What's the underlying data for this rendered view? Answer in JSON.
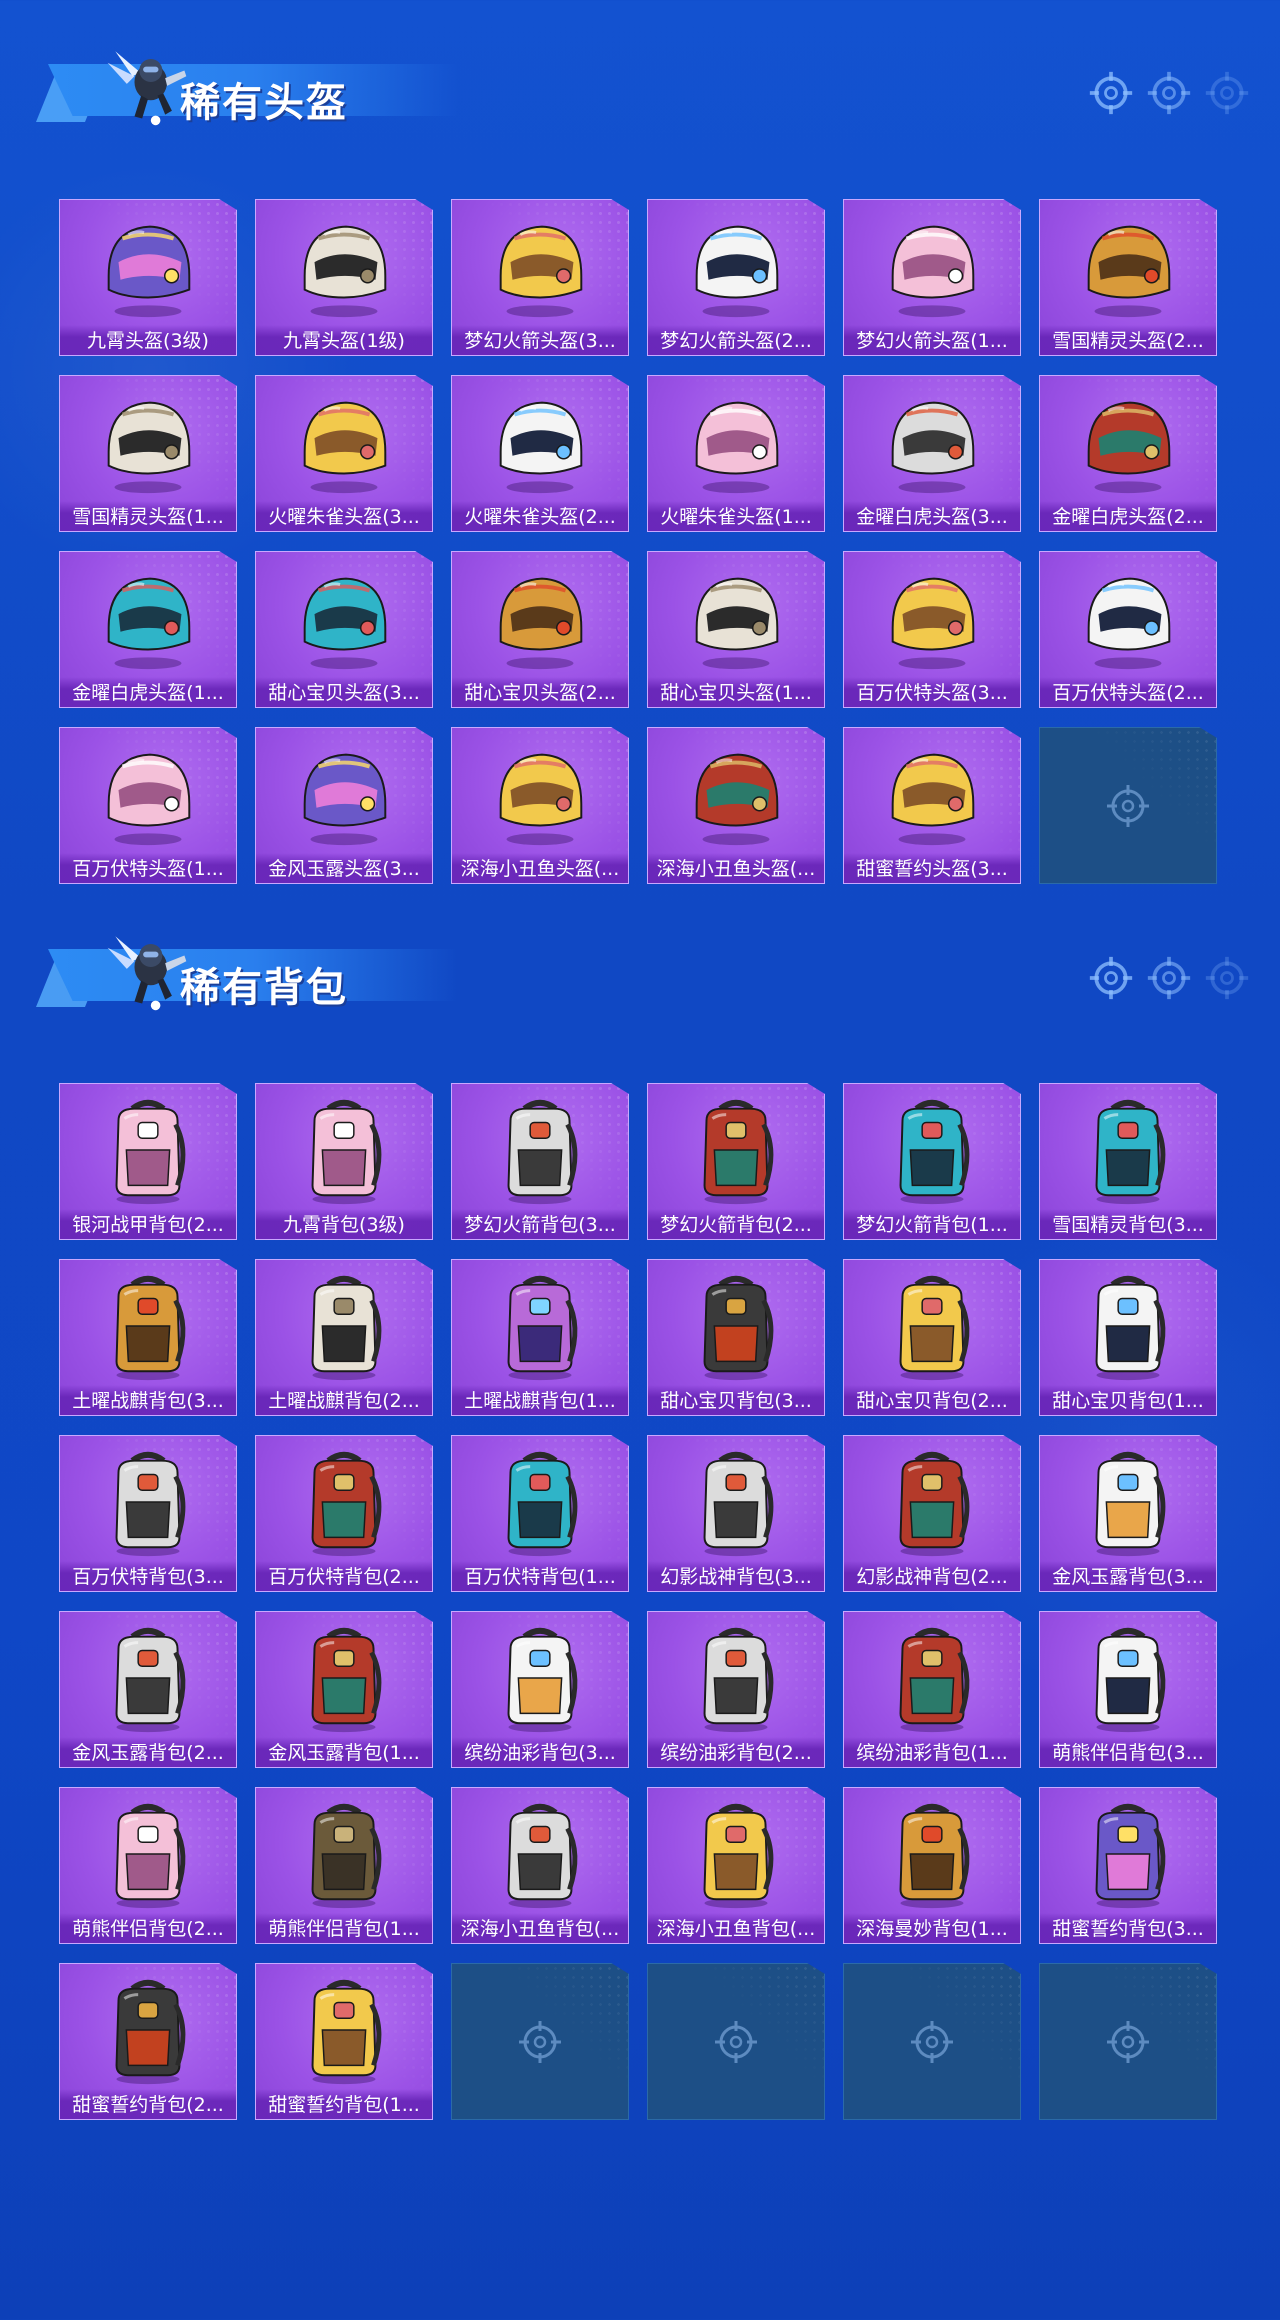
{
  "colors": {
    "background": "#1352d0",
    "card_purple": "#9b52e6",
    "card_border": "#c9a8ff",
    "empty_slot": "#1d4f86",
    "banner_blue": "#2d8cf4",
    "label_text": "#ffffff"
  },
  "sections": [
    {
      "title": "稀有头盔",
      "mascot_icon": "parachuting-character-icon",
      "items": [
        {
          "label": "九霄头盔(3级)",
          "icon": "helmet-icon"
        },
        {
          "label": "九霄头盔(1级)",
          "icon": "helmet-icon"
        },
        {
          "label": "梦幻火箭头盔(3...",
          "icon": "helmet-icon"
        },
        {
          "label": "梦幻火箭头盔(2...",
          "icon": "helmet-icon"
        },
        {
          "label": "梦幻火箭头盔(1...",
          "icon": "helmet-icon"
        },
        {
          "label": "雪国精灵头盔(2...",
          "icon": "helmet-icon"
        },
        {
          "label": "雪国精灵头盔(1...",
          "icon": "helmet-icon"
        },
        {
          "label": "火曜朱雀头盔(3...",
          "icon": "helmet-icon"
        },
        {
          "label": "火曜朱雀头盔(2...",
          "icon": "helmet-icon"
        },
        {
          "label": "火曜朱雀头盔(1...",
          "icon": "helmet-icon"
        },
        {
          "label": "金曜白虎头盔(3...",
          "icon": "helmet-icon"
        },
        {
          "label": "金曜白虎头盔(2...",
          "icon": "helmet-icon"
        },
        {
          "label": "金曜白虎头盔(1...",
          "icon": "helmet-icon"
        },
        {
          "label": "甜心宝贝头盔(3...",
          "icon": "helmet-icon"
        },
        {
          "label": "甜心宝贝头盔(2...",
          "icon": "helmet-icon"
        },
        {
          "label": "甜心宝贝头盔(1...",
          "icon": "helmet-icon"
        },
        {
          "label": "百万伏特头盔(3...",
          "icon": "helmet-icon"
        },
        {
          "label": "百万伏特头盔(2...",
          "icon": "helmet-icon"
        },
        {
          "label": "百万伏特头盔(1...",
          "icon": "helmet-icon"
        },
        {
          "label": "金风玉露头盔(3...",
          "icon": "helmet-icon"
        },
        {
          "label": "深海小丑鱼头盔(...",
          "icon": "helmet-icon"
        },
        {
          "label": "深海小丑鱼头盔(...",
          "icon": "helmet-icon"
        },
        {
          "label": "甜蜜誓约头盔(3...",
          "icon": "helmet-icon"
        }
      ],
      "empty_slots": 1
    },
    {
      "title": "稀有背包",
      "mascot_icon": "parachuting-character-icon",
      "items": [
        {
          "label": "银河战甲背包(2...",
          "icon": "backpack-icon"
        },
        {
          "label": "九霄背包(3级)",
          "icon": "backpack-icon"
        },
        {
          "label": "梦幻火箭背包(3...",
          "icon": "backpack-icon"
        },
        {
          "label": "梦幻火箭背包(2...",
          "icon": "backpack-icon"
        },
        {
          "label": "梦幻火箭背包(1...",
          "icon": "backpack-icon"
        },
        {
          "label": "雪国精灵背包(3...",
          "icon": "backpack-icon"
        },
        {
          "label": "土曜战麒背包(3...",
          "icon": "backpack-icon"
        },
        {
          "label": "土曜战麒背包(2...",
          "icon": "backpack-icon"
        },
        {
          "label": "土曜战麒背包(1...",
          "icon": "backpack-icon"
        },
        {
          "label": "甜心宝贝背包(3...",
          "icon": "backpack-icon"
        },
        {
          "label": "甜心宝贝背包(2...",
          "icon": "backpack-icon"
        },
        {
          "label": "甜心宝贝背包(1...",
          "icon": "backpack-icon"
        },
        {
          "label": "百万伏特背包(3...",
          "icon": "backpack-icon"
        },
        {
          "label": "百万伏特背包(2...",
          "icon": "backpack-icon"
        },
        {
          "label": "百万伏特背包(1...",
          "icon": "backpack-icon"
        },
        {
          "label": "幻影战神背包(3...",
          "icon": "backpack-icon"
        },
        {
          "label": "幻影战神背包(2...",
          "icon": "backpack-icon"
        },
        {
          "label": "金风玉露背包(3...",
          "icon": "backpack-icon"
        },
        {
          "label": "金风玉露背包(2...",
          "icon": "backpack-icon"
        },
        {
          "label": "金风玉露背包(1...",
          "icon": "backpack-icon"
        },
        {
          "label": "缤纷油彩背包(3...",
          "icon": "backpack-icon"
        },
        {
          "label": "缤纷油彩背包(2...",
          "icon": "backpack-icon"
        },
        {
          "label": "缤纷油彩背包(1...",
          "icon": "backpack-icon"
        },
        {
          "label": "萌熊伴侣背包(3...",
          "icon": "backpack-icon"
        },
        {
          "label": "萌熊伴侣背包(2...",
          "icon": "backpack-icon"
        },
        {
          "label": "萌熊伴侣背包(1...",
          "icon": "backpack-icon"
        },
        {
          "label": "深海小丑鱼背包(...",
          "icon": "backpack-icon"
        },
        {
          "label": "深海小丑鱼背包(...",
          "icon": "backpack-icon"
        },
        {
          "label": "深海曼妙背包(1...",
          "icon": "backpack-icon"
        },
        {
          "label": "甜蜜誓约背包(3...",
          "icon": "backpack-icon"
        },
        {
          "label": "甜蜜誓约背包(2...",
          "icon": "backpack-icon"
        },
        {
          "label": "甜蜜誓约背包(1...",
          "icon": "backpack-icon"
        }
      ],
      "empty_slots": 4
    }
  ]
}
